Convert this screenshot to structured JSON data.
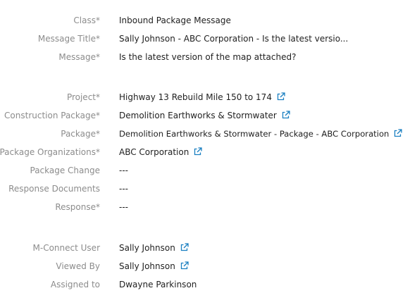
{
  "rows": [
    {
      "label": "Class*",
      "value": "Inbound Package Message",
      "link": false
    },
    {
      "label": "Message Title*",
      "value": "Sally Johnson - ABC Corporation - Is the latest versio...",
      "link": false
    },
    {
      "label": "Message*",
      "value": "Is the latest version of the map attached?",
      "link": false
    },
    {
      "label": "Project*",
      "value": "Highway 13 Rebuild Mile 150 to 174",
      "link": true
    },
    {
      "label": "Construction Package*",
      "value": "Demolition Earthworks & Stormwater",
      "link": true
    },
    {
      "label": "Package*",
      "value": "Demolition Earthworks & Stormwater - Package - ABC Corporation",
      "link": true
    },
    {
      "label": "Package Organizations*",
      "value": "ABC Corporation",
      "link": true
    },
    {
      "label": "Package Change",
      "value": "---",
      "link": false
    },
    {
      "label": "Response Documents",
      "value": "---",
      "link": false
    },
    {
      "label": "Response*",
      "value": "---",
      "link": false
    },
    {
      "label": "M-Connect User",
      "value": "Sally Johnson",
      "link": true
    },
    {
      "label": "Viewed By",
      "value": "Sally Johnson",
      "link": true
    },
    {
      "label": "Assigned to",
      "value": "Dwayne Parkinson",
      "link": false
    }
  ],
  "icons": {
    "link": "external-link-icon"
  },
  "colors": {
    "label": "#8c8c8c",
    "value": "#1f1f1f",
    "link_icon": "#1a7fc1"
  }
}
